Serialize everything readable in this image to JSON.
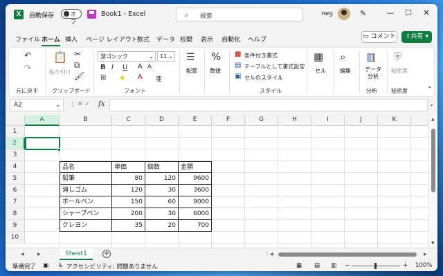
{
  "titlebar": {
    "app_icon": "excel-icon",
    "autosave_label": "自動保存",
    "autosave_state": "オフ",
    "doc_title": "Book1  -  Excel",
    "search_placeholder": "検索",
    "user_name": "neg",
    "minimize": "—",
    "maximize": "☐",
    "close": "✕"
  },
  "menu": {
    "items": [
      "ファイル",
      "ホーム",
      "挿入",
      "ページ レイアウト",
      "数式",
      "データ",
      "校閲",
      "表示",
      "自動化",
      "ヘルプ"
    ],
    "active": "ホーム",
    "comment_label": "コメント",
    "share_label": "共有"
  },
  "ribbon": {
    "groups": [
      "元に戻す",
      "クリップボード",
      "フォント",
      "配置",
      "数値",
      "スタイル",
      "セル",
      "編集",
      "分析",
      "秘密度"
    ],
    "clipboard_paste": "貼り付け",
    "font_name": "游ゴシック",
    "font_size": "11",
    "align_label": "配置",
    "number_label": "数値",
    "cond_format": "条件付き書式",
    "table_format": "テーブルとして書式設定",
    "cell_style": "セルのスタイル",
    "cells_label": "セル",
    "edit_label": "編集",
    "analyze_label_1": "データ",
    "analyze_label_2": "分析",
    "sensitivity_label": "秘密度"
  },
  "formula_bar": {
    "name_box": "A2",
    "fx": "fx",
    "value": ""
  },
  "grid": {
    "columns": [
      "A",
      "B",
      "C",
      "D",
      "E",
      "F",
      "G",
      "H",
      "I",
      "J",
      "K"
    ],
    "rows": [
      "1",
      "2",
      "3",
      "4",
      "5",
      "6",
      "7",
      "8",
      "9",
      "10"
    ],
    "selected_column": "A",
    "selected_row": "2",
    "table": {
      "headers": [
        "品名",
        "単価",
        "個数",
        "金額"
      ],
      "rows": [
        [
          "鉛筆",
          "80",
          "120",
          "9600"
        ],
        [
          "消しゴム",
          "120",
          "30",
          "3600"
        ],
        [
          "ボールペン",
          "150",
          "60",
          "9000"
        ],
        [
          "シャープペン",
          "200",
          "30",
          "6000"
        ],
        [
          "クレヨン",
          "35",
          "20",
          "700"
        ]
      ]
    }
  },
  "sheets": {
    "active": "Sheet1",
    "add_label": "+"
  },
  "status": {
    "ready": "準備完了",
    "accessibility": "アクセシビリティ: 問題ありません",
    "zoom": "100%",
    "zoom_minus": "−",
    "zoom_plus": "+"
  }
}
